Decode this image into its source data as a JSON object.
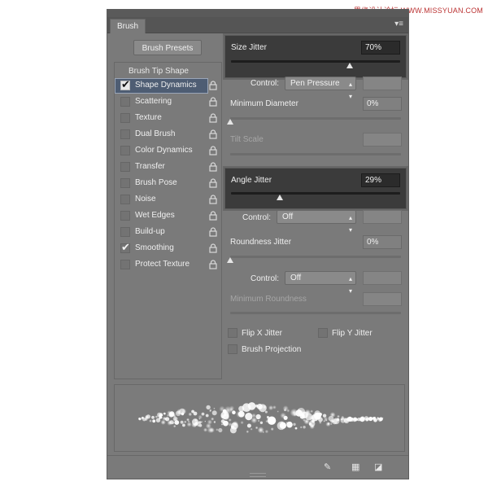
{
  "watermark": "思缘设计论坛 WWW.MISSYUAN.COM",
  "panel": {
    "tab_label": "Brush",
    "presets_button": "Brush Presets",
    "tip_shape_label": "Brush Tip Shape"
  },
  "left_items": [
    {
      "label": "Shape Dynamics",
      "checked": true,
      "selected": true
    },
    {
      "label": "Scattering",
      "checked": false,
      "selected": false
    },
    {
      "label": "Texture",
      "checked": false,
      "selected": false
    },
    {
      "label": "Dual Brush",
      "checked": false,
      "selected": false
    },
    {
      "label": "Color Dynamics",
      "checked": false,
      "selected": false
    },
    {
      "label": "Transfer",
      "checked": false,
      "selected": false
    },
    {
      "label": "Brush Pose",
      "checked": false,
      "selected": false
    },
    {
      "label": "Noise",
      "checked": false,
      "selected": false
    },
    {
      "label": "Wet Edges",
      "checked": false,
      "selected": false
    },
    {
      "label": "Build-up",
      "checked": false,
      "selected": false
    },
    {
      "label": "Smoothing",
      "checked": true,
      "selected": false
    },
    {
      "label": "Protect Texture",
      "checked": false,
      "selected": false
    }
  ],
  "settings": {
    "size_jitter": {
      "label": "Size Jitter",
      "value": "70%",
      "level": 70
    },
    "control1": {
      "label": "Control:",
      "value": "Pen Pressure"
    },
    "min_diameter": {
      "label": "Minimum Diameter",
      "value": "0%",
      "level": 0
    },
    "tilt_scale": {
      "label": "Tilt Scale"
    },
    "angle_jitter": {
      "label": "Angle Jitter",
      "value": "29%",
      "level": 29
    },
    "control2": {
      "label": "Control:",
      "value": "Off"
    },
    "roundness_jitter": {
      "label": "Roundness Jitter",
      "value": "0%",
      "level": 0
    },
    "control3": {
      "label": "Control:",
      "value": "Off"
    },
    "min_roundness": {
      "label": "Minimum Roundness"
    },
    "flip_x": "Flip X Jitter",
    "flip_y": "Flip Y Jitter",
    "brush_projection": "Brush Projection"
  },
  "colors": {
    "panel_bg": "#7a7a7a",
    "highlight_bg": "#3b3b3b",
    "selection_bg": "#4e5d73"
  },
  "icons": [
    "panel-menu-icon",
    "lock-icon",
    "pressure-toggle-icon",
    "grid-icon",
    "new-preset-icon",
    "dropdown-arrow-icon"
  ]
}
